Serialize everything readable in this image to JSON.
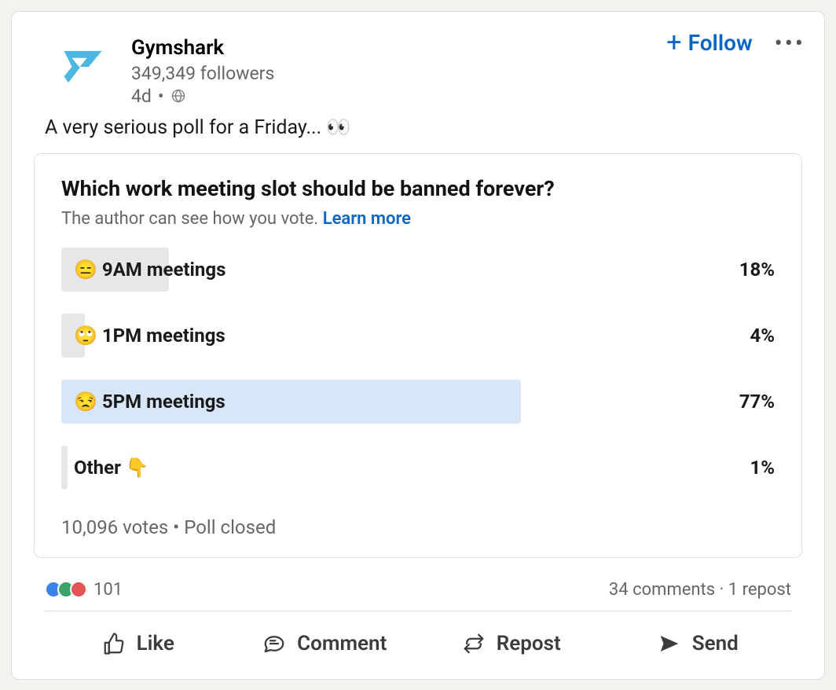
{
  "post": {
    "author": "Gymshark",
    "followers": "349,349 followers",
    "time": "4d",
    "visibility_icon": "globe",
    "follow_label": "Follow",
    "body_text": "A very serious poll for a Friday... 👀"
  },
  "poll": {
    "question": "Which work meeting slot should be banned forever?",
    "subtext": "The author can see how you vote.",
    "learn_more": "Learn more",
    "options": [
      {
        "label": "😑 9AM meetings",
        "pct": "18%",
        "width": 18,
        "selected": false
      },
      {
        "label": "🙄 1PM meetings",
        "pct": "4%",
        "width": 4,
        "selected": false
      },
      {
        "label": "😒 5PM meetings",
        "pct": "77%",
        "width": 77,
        "selected": true
      },
      {
        "label": "Other 👇",
        "pct": "1%",
        "width": 1,
        "selected": false
      }
    ],
    "footer_votes": "10,096 votes",
    "footer_status": "Poll closed"
  },
  "social": {
    "reaction_count": "101",
    "comments": "34 comments",
    "reposts": "1 repost"
  },
  "actions": {
    "like": "Like",
    "comment": "Comment",
    "repost": "Repost",
    "send": "Send"
  },
  "chart_data": {
    "type": "bar",
    "title": "Which work meeting slot should be banned forever?",
    "categories": [
      "9AM meetings",
      "1PM meetings",
      "5PM meetings",
      "Other"
    ],
    "values": [
      18,
      4,
      77,
      1
    ],
    "xlabel": "",
    "ylabel": "%",
    "ylim": [
      0,
      100
    ]
  }
}
